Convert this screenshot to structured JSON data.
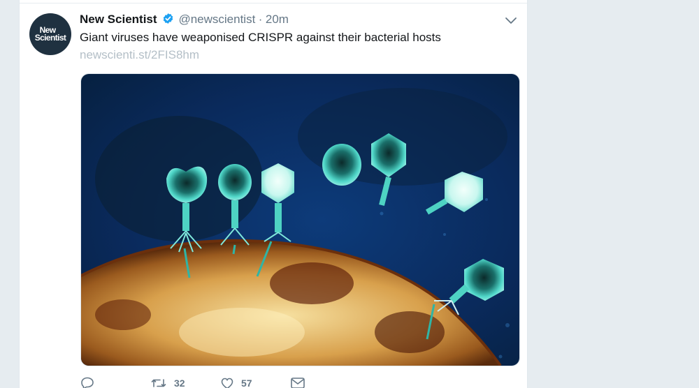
{
  "account": {
    "name": "New Scientist",
    "handle": "@newscientist",
    "separator": "·",
    "time": "20m",
    "verified": true,
    "avatar_line1": "New",
    "avatar_line2": "Scientist"
  },
  "tweet": {
    "text": "Giant viruses have weaponised CRISPR against their bacterial hosts",
    "link": "newscienti.st/2FIS8hm"
  },
  "media": {
    "description_icon": "bacteriophage-micrograph"
  },
  "actions": {
    "reply_count": "",
    "retweet_count": "32",
    "like_count": "57"
  },
  "colors": {
    "accent": "#1da1f2",
    "text": "#14171a",
    "muted": "#657786",
    "background": "#e6ecf0"
  }
}
